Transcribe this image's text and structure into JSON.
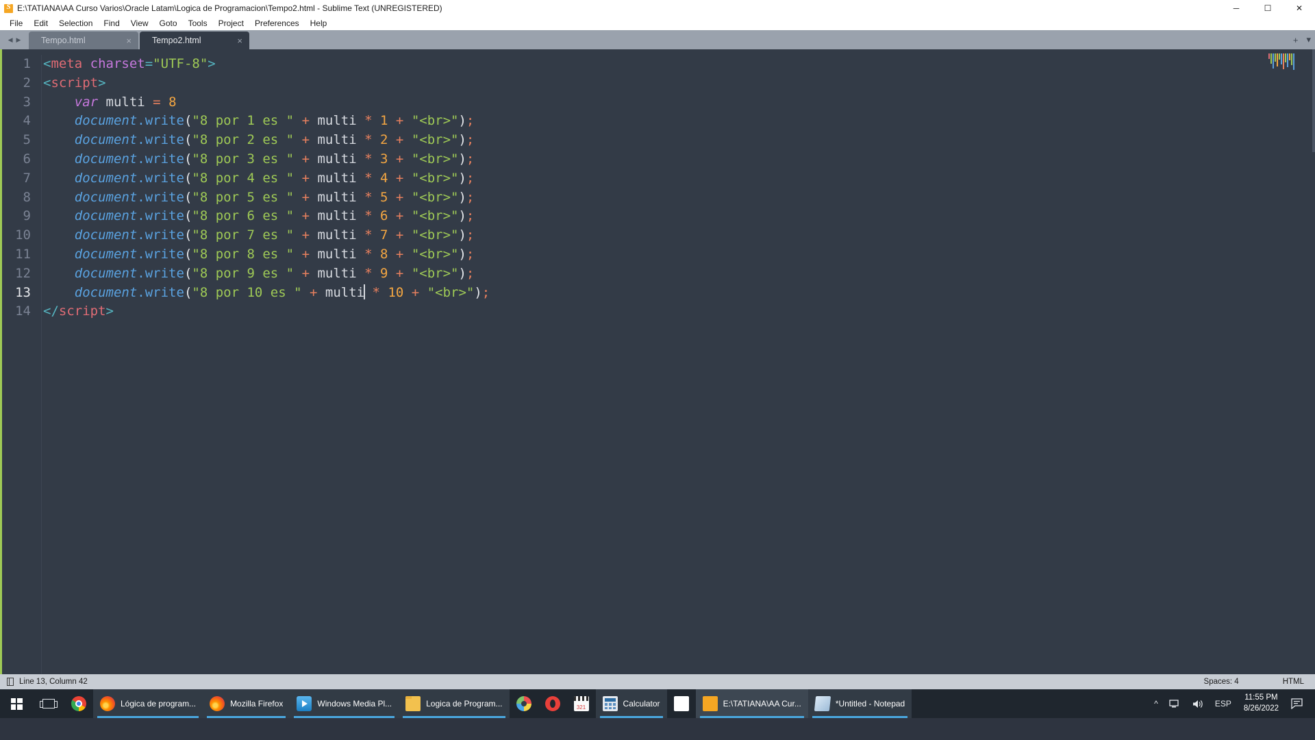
{
  "window": {
    "title": "E:\\TATIANA\\AA Curso Varios\\Oracle Latam\\Logica de Programacion\\Tempo2.html - Sublime Text (UNREGISTERED)",
    "logo_icon": "sublime-text-icon",
    "controls": {
      "minimize": "─",
      "maximize": "☐",
      "close": "✕"
    }
  },
  "menubar": {
    "items": [
      {
        "label": "File"
      },
      {
        "label": "Edit"
      },
      {
        "label": "Selection"
      },
      {
        "label": "Find"
      },
      {
        "label": "View"
      },
      {
        "label": "Goto"
      },
      {
        "label": "Tools"
      },
      {
        "label": "Project"
      },
      {
        "label": "Preferences"
      },
      {
        "label": "Help"
      }
    ]
  },
  "tabbar": {
    "prev_icon": "◀",
    "next_icon": "▶",
    "close_glyph": "×",
    "tabs": [
      {
        "label": "Tempo.html",
        "active": false
      },
      {
        "label": "Tempo2.html",
        "active": true
      }
    ],
    "new_tab_glyph": "+",
    "menu_glyph": "▾"
  },
  "editor": {
    "lines": [
      {
        "n": "1",
        "tokens": [
          {
            "t": "<",
            "c": "tok-punc"
          },
          {
            "t": "meta",
            "c": "tok-tag"
          },
          {
            "t": " ",
            "c": "tok-var"
          },
          {
            "t": "charset",
            "c": "tok-attr"
          },
          {
            "t": "=",
            "c": "tok-punc"
          },
          {
            "t": "\"UTF-8\"",
            "c": "tok-str"
          },
          {
            "t": ">",
            "c": "tok-punc"
          }
        ]
      },
      {
        "n": "2",
        "tokens": [
          {
            "t": "<",
            "c": "tok-punc"
          },
          {
            "t": "script",
            "c": "tok-tag"
          },
          {
            "t": ">",
            "c": "tok-punc"
          }
        ]
      },
      {
        "n": "3",
        "tokens": [
          {
            "t": "    ",
            "c": "tok-var"
          },
          {
            "t": "var",
            "c": "tok-kw"
          },
          {
            "t": " multi ",
            "c": "tok-var"
          },
          {
            "t": "=",
            "c": "tok-op"
          },
          {
            "t": " ",
            "c": "tok-var"
          },
          {
            "t": "8",
            "c": "tok-num"
          }
        ]
      },
      {
        "n": "4",
        "tokens": [
          {
            "t": "    ",
            "c": "tok-var"
          },
          {
            "t": "document",
            "c": "tok-obj"
          },
          {
            "t": ".",
            "c": "tok-fn"
          },
          {
            "t": "write",
            "c": "tok-fn"
          },
          {
            "t": "(",
            "c": "tok-paren"
          },
          {
            "t": "\"8 por 1 es \"",
            "c": "tok-str"
          },
          {
            "t": " ",
            "c": "tok-var"
          },
          {
            "t": "+",
            "c": "tok-op"
          },
          {
            "t": " multi ",
            "c": "tok-var"
          },
          {
            "t": "*",
            "c": "tok-op"
          },
          {
            "t": " ",
            "c": "tok-var"
          },
          {
            "t": "1",
            "c": "tok-num"
          },
          {
            "t": " ",
            "c": "tok-var"
          },
          {
            "t": "+",
            "c": "tok-op"
          },
          {
            "t": " ",
            "c": "tok-var"
          },
          {
            "t": "\"<br>\"",
            "c": "tok-str"
          },
          {
            "t": ")",
            "c": "tok-paren"
          },
          {
            "t": ";",
            "c": "tok-op"
          }
        ]
      },
      {
        "n": "5",
        "tokens": [
          {
            "t": "    ",
            "c": "tok-var"
          },
          {
            "t": "document",
            "c": "tok-obj"
          },
          {
            "t": ".",
            "c": "tok-fn"
          },
          {
            "t": "write",
            "c": "tok-fn"
          },
          {
            "t": "(",
            "c": "tok-paren"
          },
          {
            "t": "\"8 por 2 es \"",
            "c": "tok-str"
          },
          {
            "t": " ",
            "c": "tok-var"
          },
          {
            "t": "+",
            "c": "tok-op"
          },
          {
            "t": " multi ",
            "c": "tok-var"
          },
          {
            "t": "*",
            "c": "tok-op"
          },
          {
            "t": " ",
            "c": "tok-var"
          },
          {
            "t": "2",
            "c": "tok-num"
          },
          {
            "t": " ",
            "c": "tok-var"
          },
          {
            "t": "+",
            "c": "tok-op"
          },
          {
            "t": " ",
            "c": "tok-var"
          },
          {
            "t": "\"<br>\"",
            "c": "tok-str"
          },
          {
            "t": ")",
            "c": "tok-paren"
          },
          {
            "t": ";",
            "c": "tok-op"
          }
        ]
      },
      {
        "n": "6",
        "tokens": [
          {
            "t": "    ",
            "c": "tok-var"
          },
          {
            "t": "document",
            "c": "tok-obj"
          },
          {
            "t": ".",
            "c": "tok-fn"
          },
          {
            "t": "write",
            "c": "tok-fn"
          },
          {
            "t": "(",
            "c": "tok-paren"
          },
          {
            "t": "\"8 por 3 es \"",
            "c": "tok-str"
          },
          {
            "t": " ",
            "c": "tok-var"
          },
          {
            "t": "+",
            "c": "tok-op"
          },
          {
            "t": " multi ",
            "c": "tok-var"
          },
          {
            "t": "*",
            "c": "tok-op"
          },
          {
            "t": " ",
            "c": "tok-var"
          },
          {
            "t": "3",
            "c": "tok-num"
          },
          {
            "t": " ",
            "c": "tok-var"
          },
          {
            "t": "+",
            "c": "tok-op"
          },
          {
            "t": " ",
            "c": "tok-var"
          },
          {
            "t": "\"<br>\"",
            "c": "tok-str"
          },
          {
            "t": ")",
            "c": "tok-paren"
          },
          {
            "t": ";",
            "c": "tok-op"
          }
        ]
      },
      {
        "n": "7",
        "tokens": [
          {
            "t": "    ",
            "c": "tok-var"
          },
          {
            "t": "document",
            "c": "tok-obj"
          },
          {
            "t": ".",
            "c": "tok-fn"
          },
          {
            "t": "write",
            "c": "tok-fn"
          },
          {
            "t": "(",
            "c": "tok-paren"
          },
          {
            "t": "\"8 por 4 es \"",
            "c": "tok-str"
          },
          {
            "t": " ",
            "c": "tok-var"
          },
          {
            "t": "+",
            "c": "tok-op"
          },
          {
            "t": " multi ",
            "c": "tok-var"
          },
          {
            "t": "*",
            "c": "tok-op"
          },
          {
            "t": " ",
            "c": "tok-var"
          },
          {
            "t": "4",
            "c": "tok-num"
          },
          {
            "t": " ",
            "c": "tok-var"
          },
          {
            "t": "+",
            "c": "tok-op"
          },
          {
            "t": " ",
            "c": "tok-var"
          },
          {
            "t": "\"<br>\"",
            "c": "tok-str"
          },
          {
            "t": ")",
            "c": "tok-paren"
          },
          {
            "t": ";",
            "c": "tok-op"
          }
        ]
      },
      {
        "n": "8",
        "tokens": [
          {
            "t": "    ",
            "c": "tok-var"
          },
          {
            "t": "document",
            "c": "tok-obj"
          },
          {
            "t": ".",
            "c": "tok-fn"
          },
          {
            "t": "write",
            "c": "tok-fn"
          },
          {
            "t": "(",
            "c": "tok-paren"
          },
          {
            "t": "\"8 por 5 es \"",
            "c": "tok-str"
          },
          {
            "t": " ",
            "c": "tok-var"
          },
          {
            "t": "+",
            "c": "tok-op"
          },
          {
            "t": " multi ",
            "c": "tok-var"
          },
          {
            "t": "*",
            "c": "tok-op"
          },
          {
            "t": " ",
            "c": "tok-var"
          },
          {
            "t": "5",
            "c": "tok-num"
          },
          {
            "t": " ",
            "c": "tok-var"
          },
          {
            "t": "+",
            "c": "tok-op"
          },
          {
            "t": " ",
            "c": "tok-var"
          },
          {
            "t": "\"<br>\"",
            "c": "tok-str"
          },
          {
            "t": ")",
            "c": "tok-paren"
          },
          {
            "t": ";",
            "c": "tok-op"
          }
        ]
      },
      {
        "n": "9",
        "tokens": [
          {
            "t": "    ",
            "c": "tok-var"
          },
          {
            "t": "document",
            "c": "tok-obj"
          },
          {
            "t": ".",
            "c": "tok-fn"
          },
          {
            "t": "write",
            "c": "tok-fn"
          },
          {
            "t": "(",
            "c": "tok-paren"
          },
          {
            "t": "\"8 por 6 es \"",
            "c": "tok-str"
          },
          {
            "t": " ",
            "c": "tok-var"
          },
          {
            "t": "+",
            "c": "tok-op"
          },
          {
            "t": " multi ",
            "c": "tok-var"
          },
          {
            "t": "*",
            "c": "tok-op"
          },
          {
            "t": " ",
            "c": "tok-var"
          },
          {
            "t": "6",
            "c": "tok-num"
          },
          {
            "t": " ",
            "c": "tok-var"
          },
          {
            "t": "+",
            "c": "tok-op"
          },
          {
            "t": " ",
            "c": "tok-var"
          },
          {
            "t": "\"<br>\"",
            "c": "tok-str"
          },
          {
            "t": ")",
            "c": "tok-paren"
          },
          {
            "t": ";",
            "c": "tok-op"
          }
        ]
      },
      {
        "n": "10",
        "tokens": [
          {
            "t": "    ",
            "c": "tok-var"
          },
          {
            "t": "document",
            "c": "tok-obj"
          },
          {
            "t": ".",
            "c": "tok-fn"
          },
          {
            "t": "write",
            "c": "tok-fn"
          },
          {
            "t": "(",
            "c": "tok-paren"
          },
          {
            "t": "\"8 por 7 es \"",
            "c": "tok-str"
          },
          {
            "t": " ",
            "c": "tok-var"
          },
          {
            "t": "+",
            "c": "tok-op"
          },
          {
            "t": " multi ",
            "c": "tok-var"
          },
          {
            "t": "*",
            "c": "tok-op"
          },
          {
            "t": " ",
            "c": "tok-var"
          },
          {
            "t": "7",
            "c": "tok-num"
          },
          {
            "t": " ",
            "c": "tok-var"
          },
          {
            "t": "+",
            "c": "tok-op"
          },
          {
            "t": " ",
            "c": "tok-var"
          },
          {
            "t": "\"<br>\"",
            "c": "tok-str"
          },
          {
            "t": ")",
            "c": "tok-paren"
          },
          {
            "t": ";",
            "c": "tok-op"
          }
        ]
      },
      {
        "n": "11",
        "tokens": [
          {
            "t": "    ",
            "c": "tok-var"
          },
          {
            "t": "document",
            "c": "tok-obj"
          },
          {
            "t": ".",
            "c": "tok-fn"
          },
          {
            "t": "write",
            "c": "tok-fn"
          },
          {
            "t": "(",
            "c": "tok-paren"
          },
          {
            "t": "\"8 por 8 es \"",
            "c": "tok-str"
          },
          {
            "t": " ",
            "c": "tok-var"
          },
          {
            "t": "+",
            "c": "tok-op"
          },
          {
            "t": " multi ",
            "c": "tok-var"
          },
          {
            "t": "*",
            "c": "tok-op"
          },
          {
            "t": " ",
            "c": "tok-var"
          },
          {
            "t": "8",
            "c": "tok-num"
          },
          {
            "t": " ",
            "c": "tok-var"
          },
          {
            "t": "+",
            "c": "tok-op"
          },
          {
            "t": " ",
            "c": "tok-var"
          },
          {
            "t": "\"<br>\"",
            "c": "tok-str"
          },
          {
            "t": ")",
            "c": "tok-paren"
          },
          {
            "t": ";",
            "c": "tok-op"
          }
        ]
      },
      {
        "n": "12",
        "tokens": [
          {
            "t": "    ",
            "c": "tok-var"
          },
          {
            "t": "document",
            "c": "tok-obj"
          },
          {
            "t": ".",
            "c": "tok-fn"
          },
          {
            "t": "write",
            "c": "tok-fn"
          },
          {
            "t": "(",
            "c": "tok-paren"
          },
          {
            "t": "\"8 por 9 es \"",
            "c": "tok-str"
          },
          {
            "t": " ",
            "c": "tok-var"
          },
          {
            "t": "+",
            "c": "tok-op"
          },
          {
            "t": " multi ",
            "c": "tok-var"
          },
          {
            "t": "*",
            "c": "tok-op"
          },
          {
            "t": " ",
            "c": "tok-var"
          },
          {
            "t": "9",
            "c": "tok-num"
          },
          {
            "t": " ",
            "c": "tok-var"
          },
          {
            "t": "+",
            "c": "tok-op"
          },
          {
            "t": " ",
            "c": "tok-var"
          },
          {
            "t": "\"<br>\"",
            "c": "tok-str"
          },
          {
            "t": ")",
            "c": "tok-paren"
          },
          {
            "t": ";",
            "c": "tok-op"
          }
        ]
      },
      {
        "n": "13",
        "current": true,
        "tokens": [
          {
            "t": "    ",
            "c": "tok-var"
          },
          {
            "t": "document",
            "c": "tok-obj"
          },
          {
            "t": ".",
            "c": "tok-fn"
          },
          {
            "t": "write",
            "c": "tok-fn"
          },
          {
            "t": "(",
            "c": "tok-paren"
          },
          {
            "t": "\"8 por 10 es \"",
            "c": "tok-str"
          },
          {
            "t": " ",
            "c": "tok-var"
          },
          {
            "t": "+",
            "c": "tok-op"
          },
          {
            "t": " multi",
            "c": "tok-var"
          },
          {
            "t": "CARET",
            "c": "caret"
          },
          {
            "t": " ",
            "c": "tok-var"
          },
          {
            "t": "*",
            "c": "tok-op"
          },
          {
            "t": " ",
            "c": "tok-var"
          },
          {
            "t": "10",
            "c": "tok-num"
          },
          {
            "t": " ",
            "c": "tok-var"
          },
          {
            "t": "+",
            "c": "tok-op"
          },
          {
            "t": " ",
            "c": "tok-var"
          },
          {
            "t": "\"<br>\"",
            "c": "tok-str"
          },
          {
            "t": ")",
            "c": "tok-paren"
          },
          {
            "t": ";",
            "c": "tok-op"
          }
        ]
      },
      {
        "n": "14",
        "tokens": [
          {
            "t": "<",
            "c": "tok-punc"
          },
          {
            "t": "/",
            "c": "tok-punc"
          },
          {
            "t": "script",
            "c": "tok-tag"
          },
          {
            "t": ">",
            "c": "tok-punc"
          }
        ]
      }
    ],
    "minimap_colors": [
      "#e06c75",
      "#9fca56",
      "#5aa2e0",
      "#9fca56",
      "#f5a742",
      "#9fca56",
      "#5aa2e0",
      "#e8805e",
      "#9fca56",
      "#5aa2e0",
      "#f5a742",
      "#9fca56",
      "#5aa2e0"
    ]
  },
  "statusbar": {
    "sidebar_icon": "panel-toggle-icon",
    "position": "Line 13, Column 42",
    "indent": "Spaces: 4",
    "syntax": "HTML"
  },
  "taskbar": {
    "start_icon": "windows-start-icon",
    "taskview_icon": "task-view-icon",
    "items": [
      {
        "label": "",
        "icon": "chrome-icon",
        "icon_class": "ic-chrome",
        "state": "pinned"
      },
      {
        "label": "Lógica de program...",
        "icon": "firefox-icon",
        "icon_class": "ic-firefox",
        "state": "grouped"
      },
      {
        "label": "Mozilla Firefox",
        "icon": "firefox-icon",
        "icon_class": "ic-firefox",
        "state": "grouped"
      },
      {
        "label": "Windows Media Pl...",
        "icon": "windows-media-player-icon",
        "icon_class": "ic-wmp",
        "state": "grouped"
      },
      {
        "label": "Logica de Program...",
        "icon": "folder-icon",
        "icon_class": "ic-folder",
        "state": "grouped"
      },
      {
        "label": "",
        "icon": "paint-icon",
        "icon_class": "ic-paint",
        "state": "pinned"
      },
      {
        "label": "",
        "icon": "opera-icon",
        "icon_class": "ic-opera",
        "state": "pinned"
      },
      {
        "label": "",
        "icon": "video-editor-icon",
        "icon_class": "ic-video",
        "state": "pinned"
      },
      {
        "label": "Calculator",
        "icon": "calculator-icon",
        "icon_class": "ic-calc",
        "state": "grouped"
      },
      {
        "label": "",
        "icon": "moodle-icon",
        "icon_class": "ic-moodle",
        "state": "pinned"
      },
      {
        "label": "E:\\TATIANA\\AA Cur...",
        "icon": "sublime-text-icon",
        "icon_class": "ic-sublime",
        "state": "active"
      },
      {
        "label": "*Untitled - Notepad",
        "icon": "notepad-icon",
        "icon_class": "ic-notepad",
        "state": "grouped"
      }
    ],
    "tray": {
      "show_hidden_icon": "chevron-up-icon",
      "network_icon": "network-icon",
      "volume_icon": "volume-icon",
      "language": "ESP",
      "time": "11:55 PM",
      "date": "8/26/2022",
      "notifications_icon": "action-center-icon"
    }
  }
}
